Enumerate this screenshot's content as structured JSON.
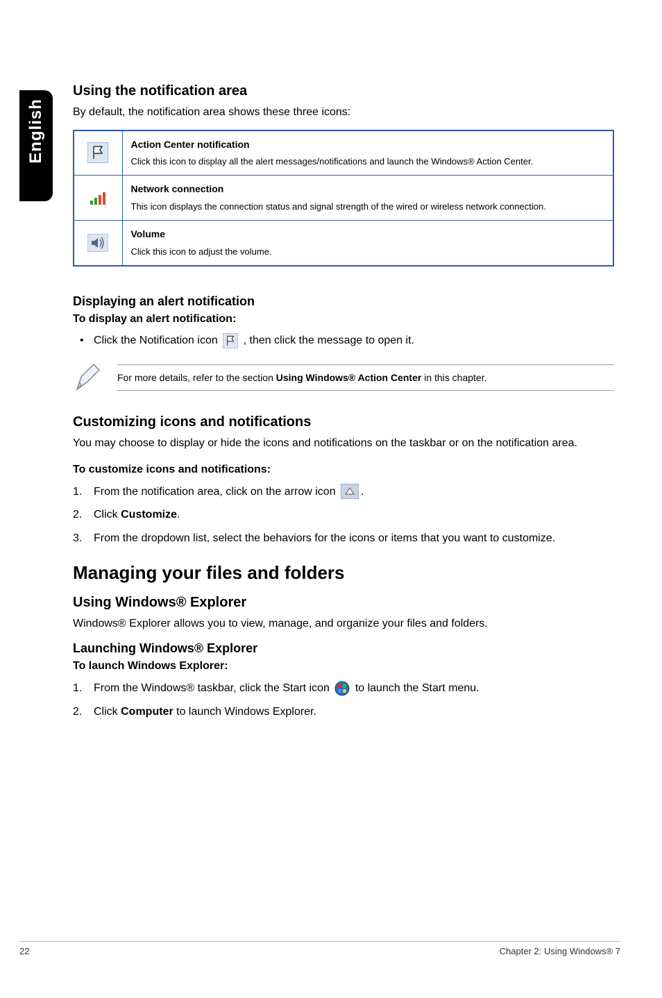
{
  "sidetab": "English",
  "section1": {
    "title": "Using the notification area",
    "lead": "By default, the notification area shows these three icons:",
    "rows": [
      {
        "title": "Action Center notification",
        "desc": "Click this icon to display all the alert messages/notifications and launch the Windows® Action Center."
      },
      {
        "title": "Network connection",
        "desc": "This icon displays the connection status and signal strength of the wired or wireless network connection."
      },
      {
        "title": "Volume",
        "desc": "Click this icon to adjust the volume."
      }
    ]
  },
  "alert": {
    "heading": "Displaying an alert notification",
    "subheading": "To display an alert notification:",
    "bullet_pre": "Click the Notification icon ",
    "bullet_post": ", then click the message to open it."
  },
  "note": {
    "pre": "For more details, refer to the section ",
    "bold": "Using Windows® Action Center",
    "post": " in this chapter."
  },
  "customize": {
    "heading": "Customizing icons and notifications",
    "lead": "You may choose to display or hide the icons and notifications on the taskbar or on the notification area.",
    "subheading": "To customize icons and notifications:",
    "step1_pre": "From the notification area, click on the arrow icon ",
    "step1_post": ".",
    "step2_pre": "Click ",
    "step2_bold": "Customize",
    "step2_post": ".",
    "step3": "From the dropdown list, select the behaviors for the icons or items that you want to customize."
  },
  "managing": {
    "heading": "Managing your files and folders",
    "sub1": "Using Windows® Explorer",
    "lead": "Windows® Explorer allows you to view, manage, and organize your files and folders.",
    "sub2": "Launching Windows® Explorer",
    "sub3": "To launch Windows Explorer:",
    "step1_pre": "From the Windows® taskbar, click the Start icon ",
    "step1_post": " to launch the Start menu.",
    "step2_pre": "Click ",
    "step2_bold": "Computer",
    "step2_post": " to launch Windows Explorer."
  },
  "footer": {
    "page": "22",
    "chapter": "Chapter 2: Using Windows® 7"
  }
}
